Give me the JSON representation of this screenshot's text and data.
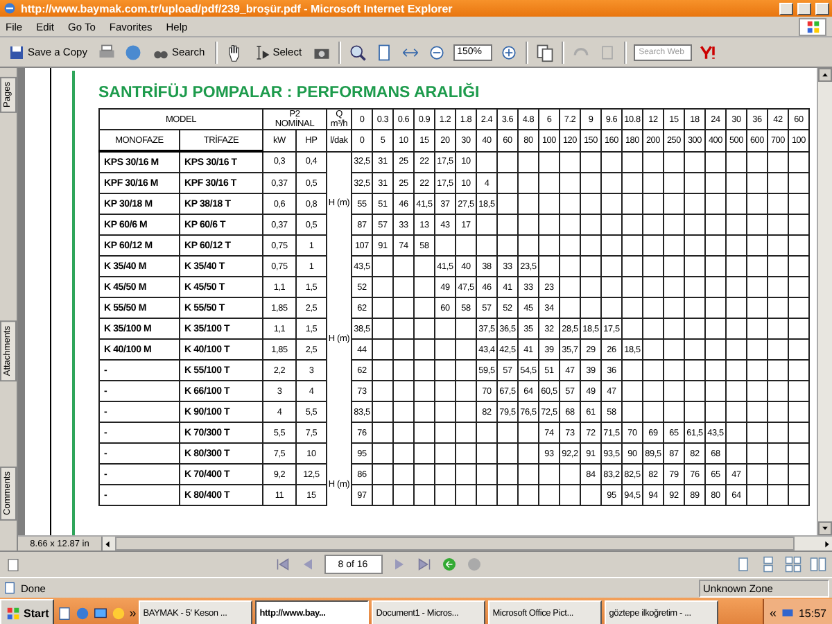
{
  "window": {
    "title": "http://www.baymak.com.tr/upload/pdf/239_broşür.pdf - Microsoft Internet Explorer"
  },
  "menu": [
    "File",
    "Edit",
    "Go To",
    "Favorites",
    "Help"
  ],
  "toolbar": {
    "save_label": "Save a Copy",
    "search_label": "Search",
    "select_label": "Select",
    "zoom_value": "150%",
    "search_placeholder": "Search Web"
  },
  "side_tabs": [
    {
      "label": "Pages",
      "selected": false
    },
    {
      "label": "Attachments",
      "selected": false
    },
    {
      "label": "Comments",
      "selected": false
    }
  ],
  "page_title": "SANTRİFÜJ POMPALAR : PERFORMANS ARALIĞI",
  "table": {
    "model": "MODEL",
    "monofaze": "MONOFAZE",
    "trifaze": "TRİFAZE",
    "p2": "P2",
    "nominal": "NOMİNAL",
    "kw": "kW",
    "hp": "HP",
    "q": "Q",
    "q_unit": "m³/h",
    "l_unit": "l/dak",
    "flow_m3h": [
      "0",
      "0.3",
      "0.6",
      "0.9",
      "1.2",
      "1.8",
      "2.4",
      "3.6",
      "4.8",
      "6",
      "7.2",
      "9",
      "9.6",
      "10.8",
      "12",
      "15",
      "18",
      "24",
      "30",
      "36",
      "42",
      "60"
    ],
    "flow_lmin": [
      "0",
      "5",
      "10",
      "15",
      "20",
      "30",
      "40",
      "60",
      "80",
      "100",
      "120",
      "150",
      "160",
      "180",
      "200",
      "250",
      "300",
      "400",
      "500",
      "600",
      "700",
      "100"
    ],
    "groups": [
      {
        "h_label": "H (m)",
        "rows": [
          {
            "mono": "KPS 30/16 M",
            "tri": "KPS 30/16 T",
            "kw": "0,3",
            "hp": "0,4",
            "cells": {
              "c0": "32,5",
              "c1": "31",
              "c2": "25",
              "c3": "22",
              "c4": "17,5",
              "c5": "10"
            }
          },
          {
            "mono": "KPF 30/16 M",
            "tri": "KPF 30/16 T",
            "kw": "0,37",
            "hp": "0,5",
            "cells": {
              "c0": "32,5",
              "c1": "31",
              "c2": "25",
              "c3": "22",
              "c4": "17,5",
              "c5": "10",
              "c6": "4"
            }
          },
          {
            "mono": "KP 30/18 M",
            "tri": "KP 38/18 T",
            "kw": "0,6",
            "hp": "0,8",
            "cells": {
              "c0": "55",
              "c1": "51",
              "c2": "46",
              "c3": "41,5",
              "c4": "37",
              "c5": "27,5",
              "c6": "18,5"
            }
          },
          {
            "mono": "KP 60/6 M",
            "tri": "KP 60/6 T",
            "kw": "0,37",
            "hp": "0,5",
            "cells": {
              "c0": "87",
              "c1": "57",
              "c2": "33",
              "c3": "13",
              "c4": "43",
              "c5": "17"
            }
          },
          {
            "mono": "KP 60/12 M",
            "tri": "KP 60/12 T",
            "kw": "0,75",
            "hp": "1",
            "cells": {
              "c0": "107",
              "c1": "91",
              "c2": "74",
              "c3": "58"
            }
          }
        ]
      },
      {
        "rows": [
          {
            "mono": "K 35/40 M",
            "tri": "K 35/40 T",
            "kw": "0,75",
            "hp": "1",
            "cells": {
              "c0": "43,5",
              "c4": "41,5",
              "c5": "40",
              "c6": "38",
              "c7": "33",
              "c8": "23,5"
            }
          },
          {
            "mono": "K 45/50 M",
            "tri": "K 45/50 T",
            "kw": "1,1",
            "hp": "1,5",
            "cells": {
              "c0": "52",
              "c4": "49",
              "c5": "47,5",
              "c6": "46",
              "c7": "41",
              "c8": "33",
              "c9": "23"
            }
          },
          {
            "mono": "K 55/50 M",
            "tri": "K 55/50 T",
            "kw": "1,85",
            "hp": "2,5",
            "cells": {
              "c0": "62",
              "c4": "60",
              "c5": "58",
              "c6": "57",
              "c7": "52",
              "c8": "45",
              "c9": "34"
            }
          }
        ]
      },
      {
        "h_label": "H (m)",
        "rows": [
          {
            "mono": "K 35/100 M",
            "tri": "K 35/100 T",
            "kw": "1,1",
            "hp": "1,5",
            "cells": {
              "c0": "38,5",
              "c6": "37,5",
              "c7": "36,5",
              "c8": "35",
              "c9": "32",
              "c10": "28,5",
              "c11": "18,5",
              "c12": "17,5"
            }
          },
          {
            "mono": "K 40/100 M",
            "tri": "K 40/100 T",
            "kw": "1,85",
            "hp": "2,5",
            "cells": {
              "c0": "44",
              "c6": "43,4",
              "c7": "42,5",
              "c8": "41",
              "c9": "39",
              "c10": "35,7",
              "c11": "29",
              "c12": "26",
              "c13": "18,5"
            }
          }
        ]
      },
      {
        "rows": [
          {
            "mono": "-",
            "tri": "K 55/100 T",
            "kw": "2,2",
            "hp": "3",
            "cells": {
              "c0": "62",
              "c6": "59,5",
              "c7": "57",
              "c8": "54,5",
              "c9": "51",
              "c10": "47",
              "c11": "39",
              "c12": "36"
            }
          },
          {
            "mono": "-",
            "tri": "K 66/100 T",
            "kw": "3",
            "hp": "4",
            "cells": {
              "c0": "73",
              "c6": "70",
              "c7": "67,5",
              "c8": "64",
              "c9": "60,5",
              "c10": "57",
              "c11": "49",
              "c12": "47"
            }
          },
          {
            "mono": "-",
            "tri": "K 90/100 T",
            "kw": "4",
            "hp": "5,5",
            "cells": {
              "c0": "83,5",
              "c6": "82",
              "c7": "79,5",
              "c8": "76,5",
              "c9": "72,5",
              "c10": "68",
              "c11": "61",
              "c12": "58"
            }
          },
          {
            "mono": "-",
            "tri": "K 70/300 T",
            "kw": "5,5",
            "hp": "7,5",
            "cells": {
              "c0": "76",
              "c9": "74",
              "c10": "73",
              "c11": "72",
              "c12": "71,5",
              "c13": "70",
              "c14": "69",
              "c15": "65",
              "c16": "61,5",
              "c17": "43,5"
            }
          },
          {
            "mono": "-",
            "tri": "K 80/300 T",
            "kw": "7,5",
            "hp": "10",
            "cells": {
              "c0": "95",
              "c9": "93",
              "c10": "92,2",
              "c11": "91",
              "c12": "93,5",
              "c13": "90",
              "c14": "89,5",
              "c15": "87",
              "c16": "82",
              "c17": "68"
            }
          }
        ]
      },
      {
        "h_label": "H (m)",
        "rows": [
          {
            "mono": "-",
            "tri": "K 70/400 T",
            "kw": "9,2",
            "hp": "12,5",
            "cells": {
              "c0": "86",
              "c11": "84",
              "c12": "83,2",
              "c13": "82,5",
              "c14": "82",
              "c15": "79",
              "c16": "76",
              "c17": "65",
              "c18": "47"
            }
          },
          {
            "mono": "-",
            "tri": "K 80/400 T",
            "kw": "11",
            "hp": "15",
            "cells": {
              "c0": "97",
              "c12": "95",
              "c13": "94,5",
              "c14": "94",
              "c15": "92",
              "c16": "89",
              "c17": "80",
              "c18": "64"
            }
          }
        ]
      }
    ]
  },
  "page_size": "8.66 x 12.87 in",
  "page_nav": "8 of 16",
  "status": {
    "text": "Done",
    "zone": "Unknown Zone"
  },
  "taskbar": {
    "start": "Start",
    "more": "»",
    "buttons": [
      {
        "label": "BAYMAK - 5' Keson ...",
        "selected": false
      },
      {
        "label": "http://www.bay...",
        "selected": true
      },
      {
        "label": "Document1 - Micros...",
        "selected": false
      },
      {
        "label": "Microsoft Office Pict...",
        "selected": false
      },
      {
        "label": "göztepe ilkoğretim - ...",
        "selected": false
      }
    ],
    "tray_more": "«",
    "time": "15:57"
  }
}
